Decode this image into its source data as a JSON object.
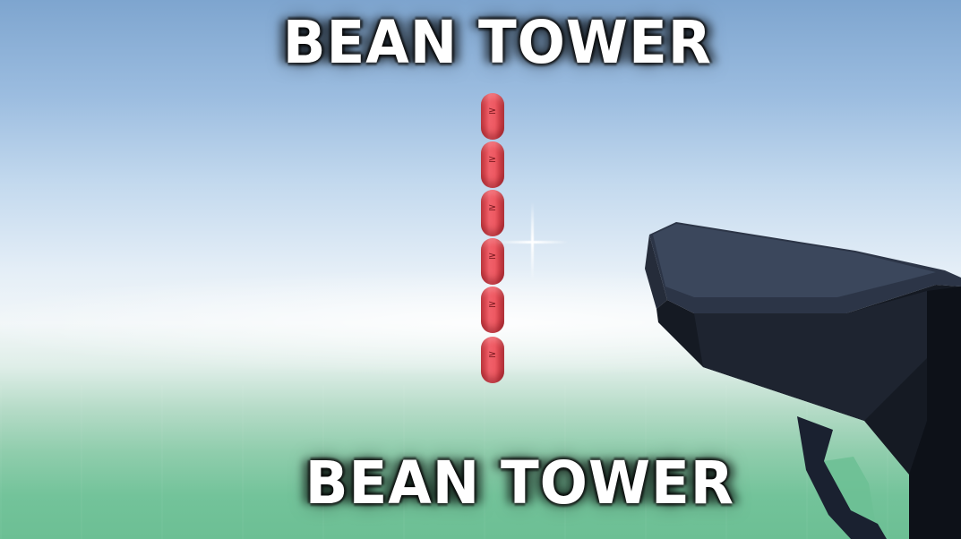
{
  "game": {
    "title_top": "BEAN TOWER",
    "title_bottom": "BEAN TOWER",
    "bean_count": 6,
    "bean_mark": "≥"
  },
  "colors": {
    "bean": "#ee5962",
    "gun": "#1a2130",
    "sky_top": "#7ea5cf",
    "ground": "#6cbf94"
  },
  "icons": {
    "crosshair": "crosshair-icon"
  }
}
